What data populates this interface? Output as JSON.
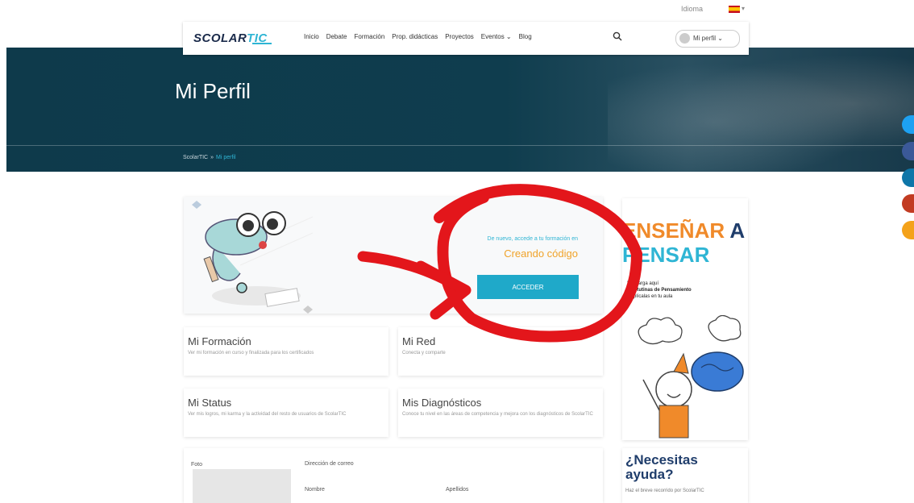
{
  "topbar": {
    "language_label": "Idioma"
  },
  "nav": {
    "logo_main": "SCOLAR",
    "logo_accent": "TIC",
    "items": [
      "Inicio",
      "Debate",
      "Formación",
      "Prop. didácticas",
      "Proyectos",
      "Eventos ⌄",
      "Blog"
    ],
    "profile_label": "Mi perfil ⌄"
  },
  "hero": {
    "title": "Mi Perfil",
    "breadcrumb_root": "ScolarTIC",
    "breadcrumb_sep": "»",
    "breadcrumb_current": "Mi perfil"
  },
  "course": {
    "welcome": "De nuevo, accede a tu formación en",
    "name": "Creando código",
    "button": "ACCEDER"
  },
  "tiles": [
    {
      "title": "Mi Formación",
      "desc": "Ver mi formación en curso y finalizada para los certificados"
    },
    {
      "title": "Mi Red",
      "desc": "Conecta y comparte"
    },
    {
      "title": "Mi Status",
      "desc": "Ver mis logros, mi karma y la actividad del resto de usuarios de ScolarTIC"
    },
    {
      "title": "Mis Diagnósticos",
      "desc": "Conoce tu nivel en las áreas de competencia y mejora con los diagnósticos de ScolarTIC"
    }
  ],
  "sidebar_ad": {
    "line1": "ENSEÑAR",
    "line1b": "A",
    "line2": "PENSAR",
    "text1": "Descarga aquí",
    "text2": "las Rutinas de Pensamiento",
    "text3": "y aplícalas en tu aula"
  },
  "help": {
    "title": "¿Necesitas ayuda?",
    "subtitle": "Haz el breve recorrido por ScolarTIC"
  },
  "profile_form": {
    "photo_label": "Foto",
    "email_label": "Dirección de correo",
    "name_label": "Nombre",
    "surname_label": "Apellidos"
  },
  "colors": {
    "hero_bg": "#0f3d4e",
    "accent": "#2fb5d4",
    "button": "#1fa9c9",
    "course_name": "#f0a32a",
    "annotation": "#e3161b"
  },
  "social_buttons": [
    {
      "icon": "twitter-icon",
      "color": "#1da1f2"
    },
    {
      "icon": "facebook-icon",
      "color": "#3b5998"
    },
    {
      "icon": "linkedin-icon",
      "color": "#0e76a8"
    },
    {
      "icon": "google-plus-icon",
      "color": "#c23b22"
    },
    {
      "icon": "rss-icon",
      "color": "#f4a21a"
    }
  ]
}
